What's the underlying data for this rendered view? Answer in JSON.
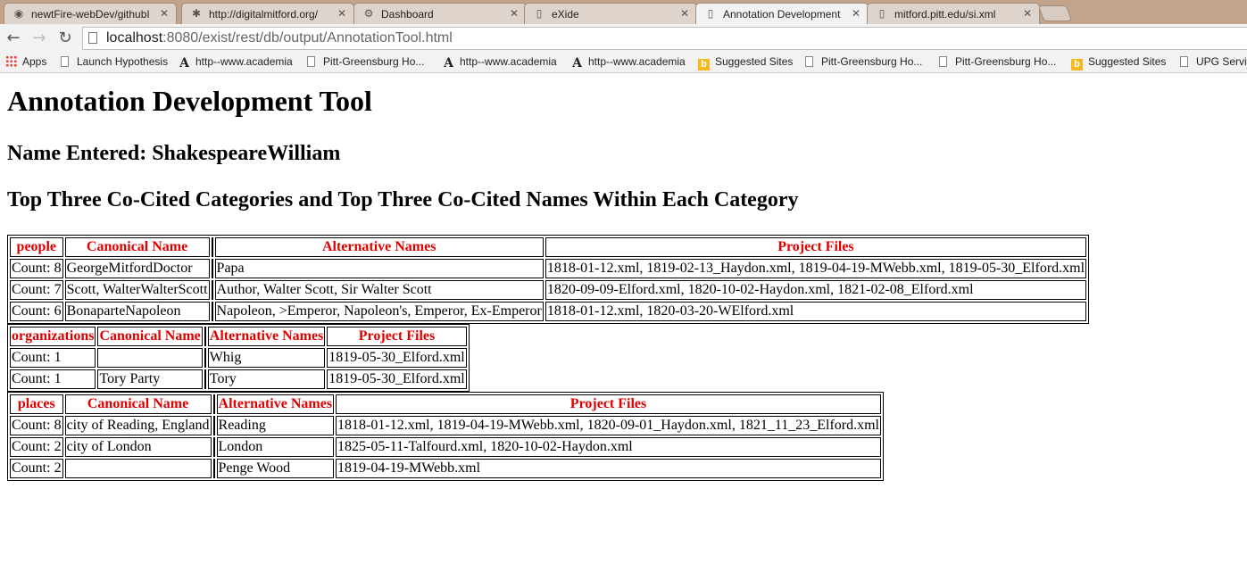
{
  "browser": {
    "tabs": [
      {
        "icon": "github-icon",
        "glyph": "◉",
        "label": "newtFire-webDev/githubI",
        "active": false
      },
      {
        "icon": "google-drive-icon",
        "glyph": "✱",
        "label": "http://digitalmitford.org/",
        "active": false
      },
      {
        "icon": "dashboard-icon",
        "glyph": "⚙",
        "label": "Dashboard",
        "active": false
      },
      {
        "icon": "page-icon",
        "glyph": "▯",
        "label": "eXide",
        "active": false
      },
      {
        "icon": "page-icon",
        "glyph": "▯",
        "label": "Annotation Development",
        "active": true
      },
      {
        "icon": "page-icon",
        "glyph": "▯",
        "label": "mitford.pitt.edu/si.xml",
        "active": false
      }
    ],
    "address": {
      "host": "localhost",
      "rest": ":8080/exist/rest/db/output/AnnotationTool.html"
    },
    "bookmarks": [
      {
        "icon": "apps-icon",
        "kind": "apps",
        "label": "Apps"
      },
      {
        "icon": "page-icon",
        "kind": "page",
        "label": "Launch Hypothesis"
      },
      {
        "icon": "academia-icon",
        "kind": "acad",
        "label": "http--www.academia"
      },
      {
        "icon": "page-icon",
        "kind": "page",
        "label": "Pitt-Greensburg Ho..."
      },
      {
        "icon": "academia-icon",
        "kind": "acad",
        "label": "http--www.academia"
      },
      {
        "icon": "academia-icon",
        "kind": "acad",
        "label": "http--www.academia"
      },
      {
        "icon": "bing-icon",
        "kind": "bing",
        "label": "Suggested Sites"
      },
      {
        "icon": "page-icon",
        "kind": "page",
        "label": "Pitt-Greensburg Ho..."
      },
      {
        "icon": "page-icon",
        "kind": "page",
        "label": "Pitt-Greensburg Ho..."
      },
      {
        "icon": "bing-icon",
        "kind": "bing",
        "label": "Suggested Sites"
      },
      {
        "icon": "page-icon",
        "kind": "page",
        "label": "UPG Servic"
      }
    ]
  },
  "page": {
    "title": "Annotation Development Tool",
    "name_entered": "Name Entered: ShakespeareWilliam",
    "subtitle": "Top Three Co-Cited Categories and Top Three Co-Cited Names Within Each Category",
    "categories": [
      {
        "headers": [
          "people",
          "Canonical Name",
          "",
          "Alternative Names",
          "Project Files"
        ],
        "rows": [
          [
            "Count: 8",
            "GeorgeMitfordDoctor",
            "",
            "Papa",
            "1818-01-12.xml, 1819-02-13_Haydon.xml, 1819-04-19-MWebb.xml, 1819-05-30_Elford.xml"
          ],
          [
            "Count: 7",
            "Scott, WalterWalterScott",
            "",
            "Author, Walter Scott, Sir Walter Scott",
            "1820-09-09-Elford.xml, 1820-10-02-Haydon.xml, 1821-02-08_Elford.xml"
          ],
          [
            "Count: 6",
            "BonaparteNapoleon",
            "",
            "Napoleon, >Emperor, Napoleon's, Emperor, Ex-Emperor",
            "1818-01-12.xml, 1820-03-20-WElford.xml"
          ]
        ]
      },
      {
        "headers": [
          "organizations",
          "Canonical Name",
          "",
          "Alternative Names",
          "Project Files"
        ],
        "rows": [
          [
            "Count: 1",
            "",
            "",
            "Whig",
            "1819-05-30_Elford.xml"
          ],
          [
            "Count: 1",
            "Tory Party",
            "",
            "Tory",
            "1819-05-30_Elford.xml"
          ]
        ]
      },
      {
        "headers": [
          "places",
          "Canonical Name",
          "",
          "Alternative Names",
          "Project Files"
        ],
        "rows": [
          [
            "Count: 8",
            "city of Reading, England",
            "",
            "Reading",
            "1818-01-12.xml, 1819-04-19-MWebb.xml, 1820-09-01_Haydon.xml, 1821_11_23_Elford.xml"
          ],
          [
            "Count: 2",
            "city of London",
            "",
            "London",
            "1825-05-11-Talfourd.xml, 1820-10-02-Haydon.xml"
          ],
          [
            "Count: 2",
            "",
            "",
            "Penge Wood",
            "1819-04-19-MWebb.xml"
          ]
        ]
      }
    ]
  }
}
